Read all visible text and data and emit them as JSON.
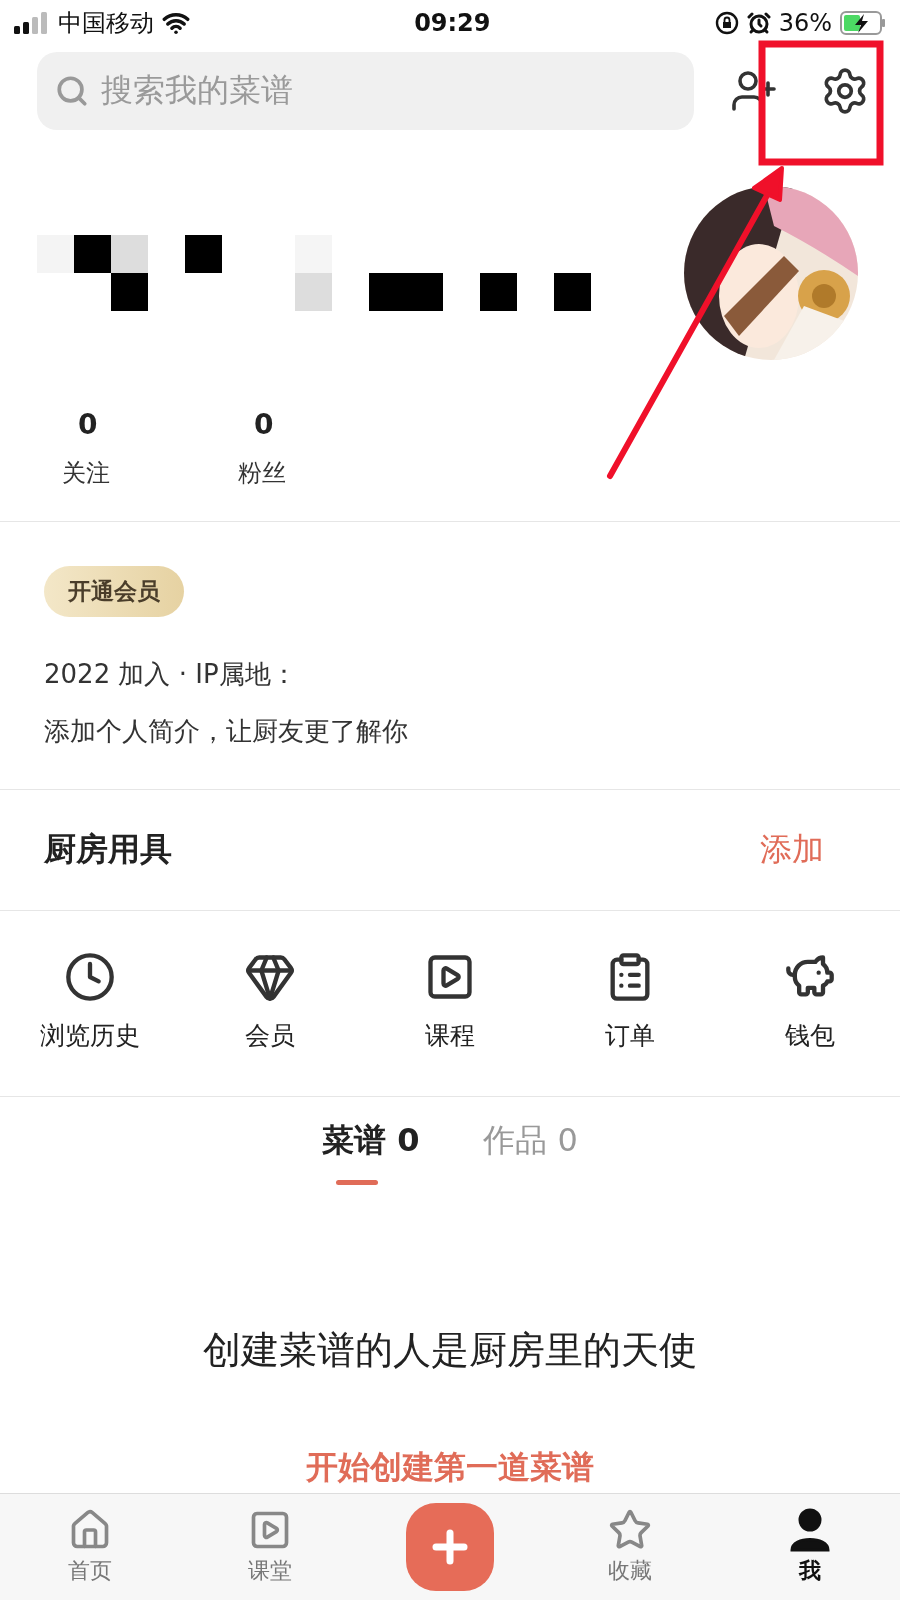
{
  "status_bar": {
    "carrier": "中国移动",
    "time": "09:29",
    "battery": "36%"
  },
  "search": {
    "placeholder": "搜索我的菜谱"
  },
  "profile": {
    "stats": [
      {
        "value": "0",
        "label": "关注"
      },
      {
        "value": "0",
        "label": "粉丝"
      }
    ],
    "member_badge": "开通会员",
    "joined": "2022 加入 · IP属地：",
    "bio": "添加个人简介，让厨友更了解你"
  },
  "kitchen": {
    "title": "厨房用具",
    "action": "添加"
  },
  "shortcuts": [
    {
      "kind": "history",
      "label": "浏览历史"
    },
    {
      "kind": "member",
      "label": "会员"
    },
    {
      "kind": "course",
      "label": "课程"
    },
    {
      "kind": "order",
      "label": "订单"
    },
    {
      "kind": "wallet",
      "label": "钱包"
    }
  ],
  "content_tabs": [
    {
      "label": "菜谱 0",
      "selected": true
    },
    {
      "label": "作品 0",
      "selected": false
    }
  ],
  "empty_state": {
    "message": "创建菜谱的人是厨房里的天使",
    "action": "开始创建第一道菜谱"
  },
  "nav": [
    {
      "kind": "home",
      "label": "首页",
      "selected": false
    },
    {
      "kind": "class",
      "label": "课堂",
      "selected": false
    },
    {
      "kind": "create",
      "selected": false
    },
    {
      "kind": "favorites",
      "label": "收藏",
      "selected": false
    },
    {
      "kind": "me",
      "label": "我",
      "selected": true
    }
  ]
}
